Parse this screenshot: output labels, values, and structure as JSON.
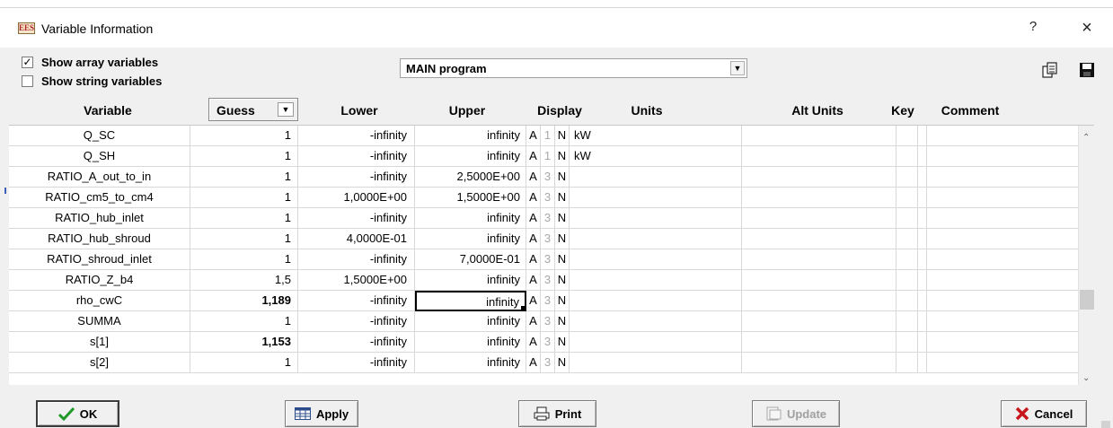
{
  "window": {
    "title": "Variable Information",
    "app_icon_text": "EES",
    "help_label": "?",
    "close_label": "×"
  },
  "options": {
    "show_array_label": "Show array variables",
    "show_array_checked": true,
    "show_string_label": "Show string variables",
    "show_string_checked": false
  },
  "program_selector": {
    "value": "MAIN program"
  },
  "toolbar_icons": [
    "copy-icon",
    "save-icon"
  ],
  "columns": {
    "variable": "Variable",
    "guess": "Guess",
    "lower": "Lower",
    "upper": "Upper",
    "display": "Display",
    "units": "Units",
    "alt_units": "Alt Units",
    "key": "Key",
    "comment": "Comment"
  },
  "rows": [
    {
      "name": "Q_SC",
      "guess": "1",
      "lower": "-infinity",
      "upper": "infinity",
      "d1": "A",
      "d2": "1",
      "d3": "N",
      "units": "kW",
      "guess_bold": false
    },
    {
      "name": "Q_SH",
      "guess": "1",
      "lower": "-infinity",
      "upper": "infinity",
      "d1": "A",
      "d2": "1",
      "d3": "N",
      "units": "kW",
      "guess_bold": false
    },
    {
      "name": "RATIO_A_out_to_in",
      "guess": "1",
      "lower": "-infinity",
      "upper": "2,5000E+00",
      "d1": "A",
      "d2": "3",
      "d3": "N",
      "units": "",
      "guess_bold": false
    },
    {
      "name": "RATIO_cm5_to_cm4",
      "guess": "1",
      "lower": "1,0000E+00",
      "upper": "1,5000E+00",
      "d1": "A",
      "d2": "3",
      "d3": "N",
      "units": "",
      "guess_bold": false
    },
    {
      "name": "RATIO_hub_inlet",
      "guess": "1",
      "lower": "-infinity",
      "upper": "infinity",
      "d1": "A",
      "d2": "3",
      "d3": "N",
      "units": "",
      "guess_bold": false
    },
    {
      "name": "RATIO_hub_shroud",
      "guess": "1",
      "lower": "4,0000E-01",
      "upper": "infinity",
      "d1": "A",
      "d2": "3",
      "d3": "N",
      "units": "",
      "guess_bold": false
    },
    {
      "name": "RATIO_shroud_inlet",
      "guess": "1",
      "lower": "-infinity",
      "upper": "7,0000E-01",
      "d1": "A",
      "d2": "3",
      "d3": "N",
      "units": "",
      "guess_bold": false
    },
    {
      "name": "RATIO_Z_b4",
      "guess": "1,5",
      "lower": "1,5000E+00",
      "upper": "infinity",
      "d1": "A",
      "d2": "3",
      "d3": "N",
      "units": "",
      "guess_bold": false
    },
    {
      "name": "rho_cwC",
      "guess": "1,189",
      "lower": "-infinity",
      "upper": "infinity",
      "d1": "A",
      "d2": "3",
      "d3": "N",
      "units": "",
      "guess_bold": true,
      "selected_upper": true
    },
    {
      "name": "SUMMA",
      "guess": "1",
      "lower": "-infinity",
      "upper": "infinity",
      "d1": "A",
      "d2": "3",
      "d3": "N",
      "units": "",
      "guess_bold": false
    },
    {
      "name": "s[1]",
      "guess": "1,153",
      "lower": "-infinity",
      "upper": "infinity",
      "d1": "A",
      "d2": "3",
      "d3": "N",
      "units": "",
      "guess_bold": true
    },
    {
      "name": "s[2]",
      "guess": "1",
      "lower": "-infinity",
      "upper": "infinity",
      "d1": "A",
      "d2": "3",
      "d3": "N",
      "units": "",
      "guess_bold": false
    }
  ],
  "buttons": {
    "ok": "OK",
    "apply": "Apply",
    "print": "Print",
    "update": "Update",
    "cancel": "Cancel"
  }
}
